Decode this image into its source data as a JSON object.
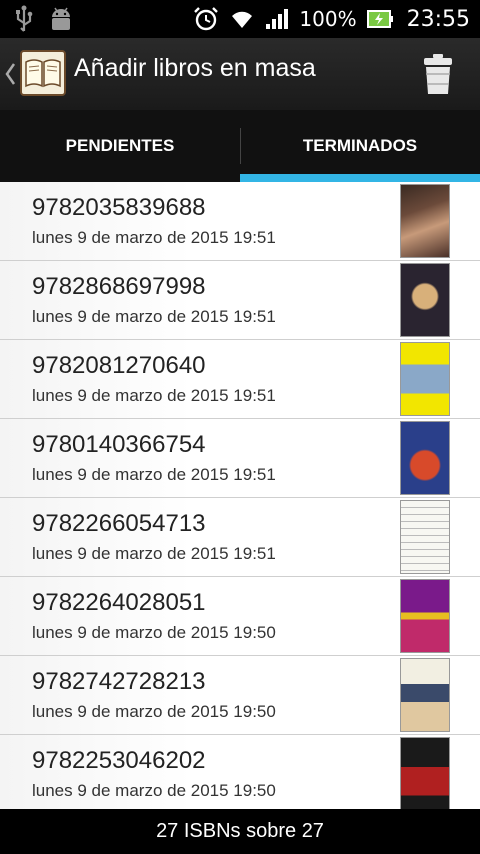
{
  "status_bar": {
    "icons": [
      "usb-icon",
      "android-debug-icon",
      "alarm-icon",
      "wifi-icon",
      "signal-icon",
      "battery-charging-icon"
    ],
    "battery": "100%",
    "time": "23:55"
  },
  "action_bar": {
    "title": "Añadir libros en masa",
    "icons": [
      "up-caret-icon",
      "book-app-icon",
      "trash-icon"
    ]
  },
  "tabs": [
    {
      "label": "PENDIENTES",
      "selected": false
    },
    {
      "label": "TERMINADOS",
      "selected": true
    }
  ],
  "colors": {
    "tab_indicator": "#33b5e5"
  },
  "items": [
    {
      "isbn": "9782035839688",
      "date": "lunes 9 de marzo de 2015 19:51",
      "cover_colors": [
        "#5a3a2e",
        "#c79a7a"
      ]
    },
    {
      "isbn": "9782868697998",
      "date": "lunes 9 de marzo de 2015 19:51",
      "cover_colors": [
        "#1a1a22",
        "#d8b07a"
      ]
    },
    {
      "isbn": "9782081270640",
      "date": "lunes 9 de marzo de 2015 19:51",
      "cover_colors": [
        "#f2e600",
        "#5a7fa8"
      ]
    },
    {
      "isbn": "9780140366754",
      "date": "lunes 9 de marzo de 2015 19:51",
      "cover_colors": [
        "#2a3f8a",
        "#d84a2a"
      ]
    },
    {
      "isbn": "9782266054713",
      "date": "lunes 9 de marzo de 2015 19:51",
      "cover_colors": [
        "#f7f7f2",
        "#8a8a8a"
      ]
    },
    {
      "isbn": "9782264028051",
      "date": "lunes 9 de marzo de 2015 19:50",
      "cover_colors": [
        "#7a1a8a",
        "#e8c020"
      ]
    },
    {
      "isbn": "9782742728213",
      "date": "lunes 9 de marzo de 2015 19:50",
      "cover_colors": [
        "#f2efe2",
        "#3a4a6a"
      ]
    },
    {
      "isbn": "9782253046202",
      "date": "lunes 9 de marzo de 2015 19:50",
      "cover_colors": [
        "#1a1a1a",
        "#b02020"
      ]
    }
  ],
  "footer": {
    "count_text": "27 ISBNs sobre 27"
  }
}
